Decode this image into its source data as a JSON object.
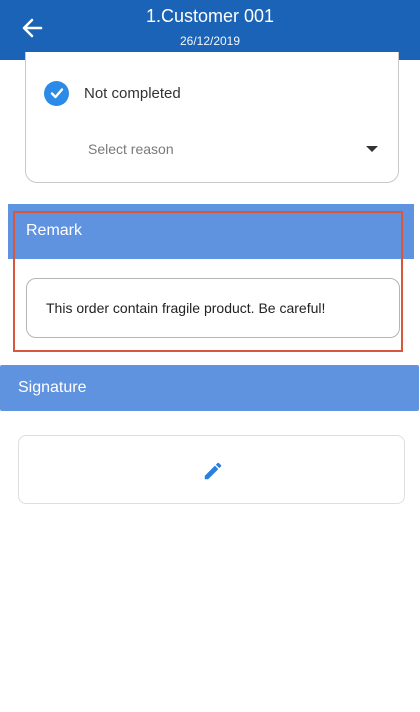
{
  "header": {
    "title": "1.Customer 001",
    "date": "26/12/2019",
    "back_icon": "arrow-left-icon",
    "background_color": "#1a63b6"
  },
  "status": {
    "checkbox_label": "Not completed",
    "checked": true,
    "check_icon": "check-circle-icon",
    "reason_placeholder": "Select reason",
    "dropdown_icon": "caret-down-icon"
  },
  "remark": {
    "title": "Remark",
    "text": "This order contain fragile product. Be careful!",
    "highlight_color": "#d9573a"
  },
  "signature": {
    "title": "Signature",
    "pad_icon": "pencil-icon"
  },
  "colors": {
    "section_bar": "#5f93e0",
    "accent": "#2b8be6"
  }
}
